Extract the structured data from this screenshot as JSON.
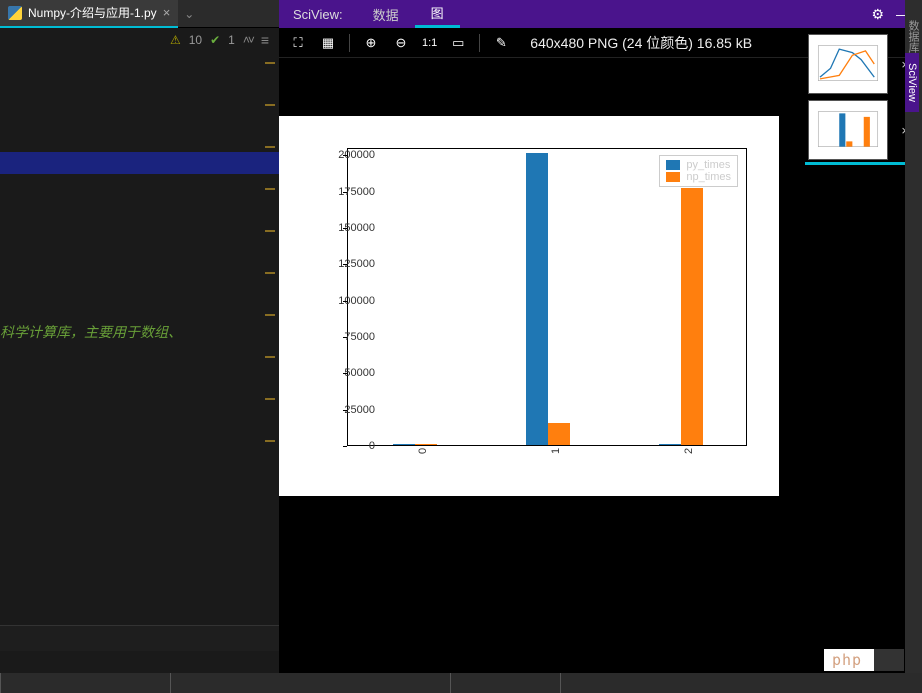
{
  "editor": {
    "file_tab": "Numpy-介绍与应用-1.py",
    "warnings": "10",
    "passes": "1",
    "comment_text": "科学计算库，主要用于数组、"
  },
  "sciview": {
    "title": "SciView:",
    "tab_data": "数据",
    "tab_plot": "图",
    "image_info": "640x480 PNG (24 位颜色) 16.85 kB",
    "toolbar": {
      "ratio": "1:1"
    }
  },
  "right_gutter": {
    "db": "数据库",
    "sv": "SciView"
  },
  "watermark": "php",
  "chart_data": {
    "type": "bar",
    "categories": [
      "0",
      "1",
      "2"
    ],
    "series": [
      {
        "name": "py_times",
        "color": "#1f77b4",
        "values": [
          900,
          201000,
          1000
        ]
      },
      {
        "name": "np_times",
        "color": "#ff7f0e",
        "values": [
          250,
          15000,
          177000
        ]
      }
    ],
    "ylim": [
      0,
      205000
    ],
    "yticks": [
      0,
      25000,
      50000,
      75000,
      100000,
      125000,
      150000,
      175000,
      200000
    ],
    "xlabel": "",
    "ylabel": "",
    "title": ""
  }
}
